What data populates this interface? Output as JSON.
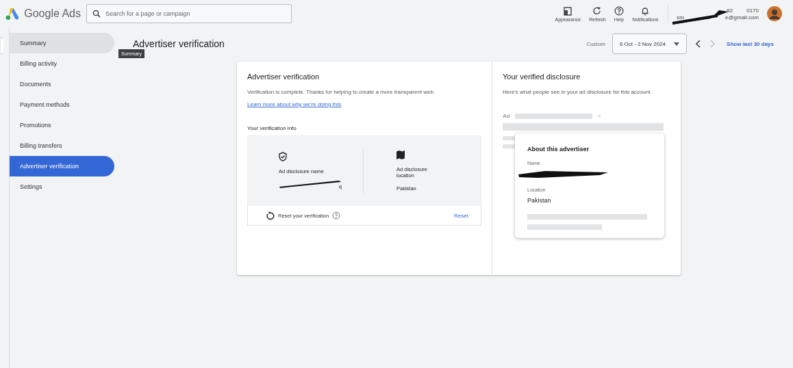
{
  "header": {
    "product": "Google Ads",
    "search": {
      "placeholder": "Search for a page or campaign"
    },
    "actions": [
      {
        "kind": "appearance",
        "label": "Appearance"
      },
      {
        "kind": "refresh",
        "label": "Refresh"
      },
      {
        "kind": "help",
        "label": "Help"
      },
      {
        "kind": "notifications",
        "label": "Notifications"
      }
    ],
    "account": {
      "id_start": "92",
      "id_end": "0170",
      "email_start": "sm",
      "email_end": "e@gmail.com"
    }
  },
  "sidebar": {
    "items": [
      {
        "label": "Summary",
        "selected": false,
        "hovered": true
      },
      {
        "label": "Billing activity",
        "selected": false,
        "hovered": false
      },
      {
        "label": "Documents",
        "selected": false,
        "hovered": false
      },
      {
        "label": "Payment methods",
        "selected": false,
        "hovered": false
      },
      {
        "label": "Promotions",
        "selected": false,
        "hovered": false
      },
      {
        "label": "Billing transfers",
        "selected": false,
        "hovered": false
      },
      {
        "label": "Advertiser verification",
        "selected": true,
        "hovered": false
      },
      {
        "label": "Settings",
        "selected": false,
        "hovered": false
      }
    ],
    "tooltip": "Summary"
  },
  "page": {
    "title": "Advertiser verification",
    "date_range": {
      "label": "Custom",
      "value": "6 Oct - 2 Nov 2024",
      "shortcut": "Show last 30 days"
    }
  },
  "verification": {
    "title": "Advertiser verification",
    "message": "Verification is complete. Thanks for helping to create a more transparent web.",
    "link": "Learn more about why we're doing this",
    "info_title": "Your verification info",
    "fields": [
      {
        "kind": "name",
        "label": "Ad disclosure name",
        "value_end": "q"
      },
      {
        "kind": "location",
        "label": "Ad disclosure location",
        "value": "Pakistan"
      }
    ],
    "reset_label": "Reset your verification",
    "reset_button": "Reset"
  },
  "disclosure": {
    "title": "Your verified disclosure",
    "description": "Here's what people see in your ad disclosure for this account.",
    "ad_label": "Ad",
    "popup": {
      "title": "About this advertiser",
      "name_label": "Name",
      "location_label": "Location",
      "location": "Pakistan"
    }
  }
}
